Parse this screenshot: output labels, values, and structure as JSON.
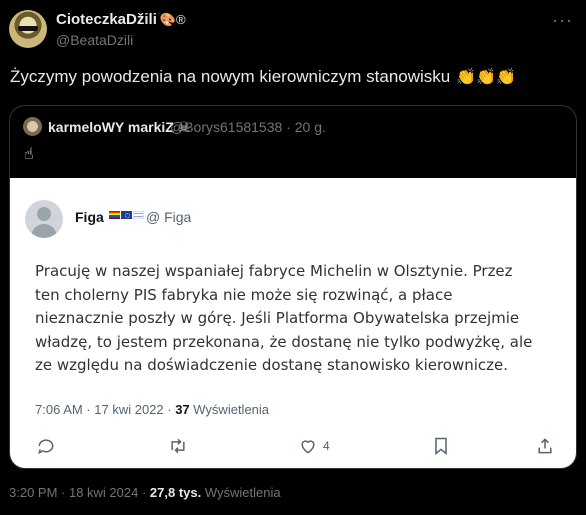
{
  "tweet": {
    "author_name": "CioteczkaDžili",
    "author_emojis": "🎨®",
    "author_handle": "@BeataDzili",
    "text": "Życzymy powodzenia na nowym kierowniczym stanowisku",
    "text_emojis": "👏👏👏",
    "more_label": "···",
    "timestamp": "3:20 PM · 18 kwi 2024 · ",
    "views_count": "27,8 tys.",
    "views_label": "Wyświetlenia"
  },
  "quote": {
    "author_name": "karmeloWY markiZ ☠",
    "author_handle": "@Borys61581538 · 20 g.",
    "text": "☝"
  },
  "screenshot": {
    "author_name": "Figa",
    "author_handle": "@ Figa",
    "body_lines": [
      "Pracuję w naszej wspaniałej fabryce Michelin w Olsztynie. Przez",
      "ten cholerny PIS fabryka nie może się rozwinąć, a płace",
      "nieznacznie poszły w górę. Jeśli Platforma Obywatelska przejmie",
      "władzę, to jestem przekonana, że dostanę nie tylko podwyżkę, ale",
      "ze względu na doświadczenie dostanę stanowisko kierownicze."
    ],
    "timestamp": "7:06 AM · 17 kwi 2022 · ",
    "views_count": "37",
    "views_label": "Wyświetlenia",
    "like_count": "4"
  }
}
